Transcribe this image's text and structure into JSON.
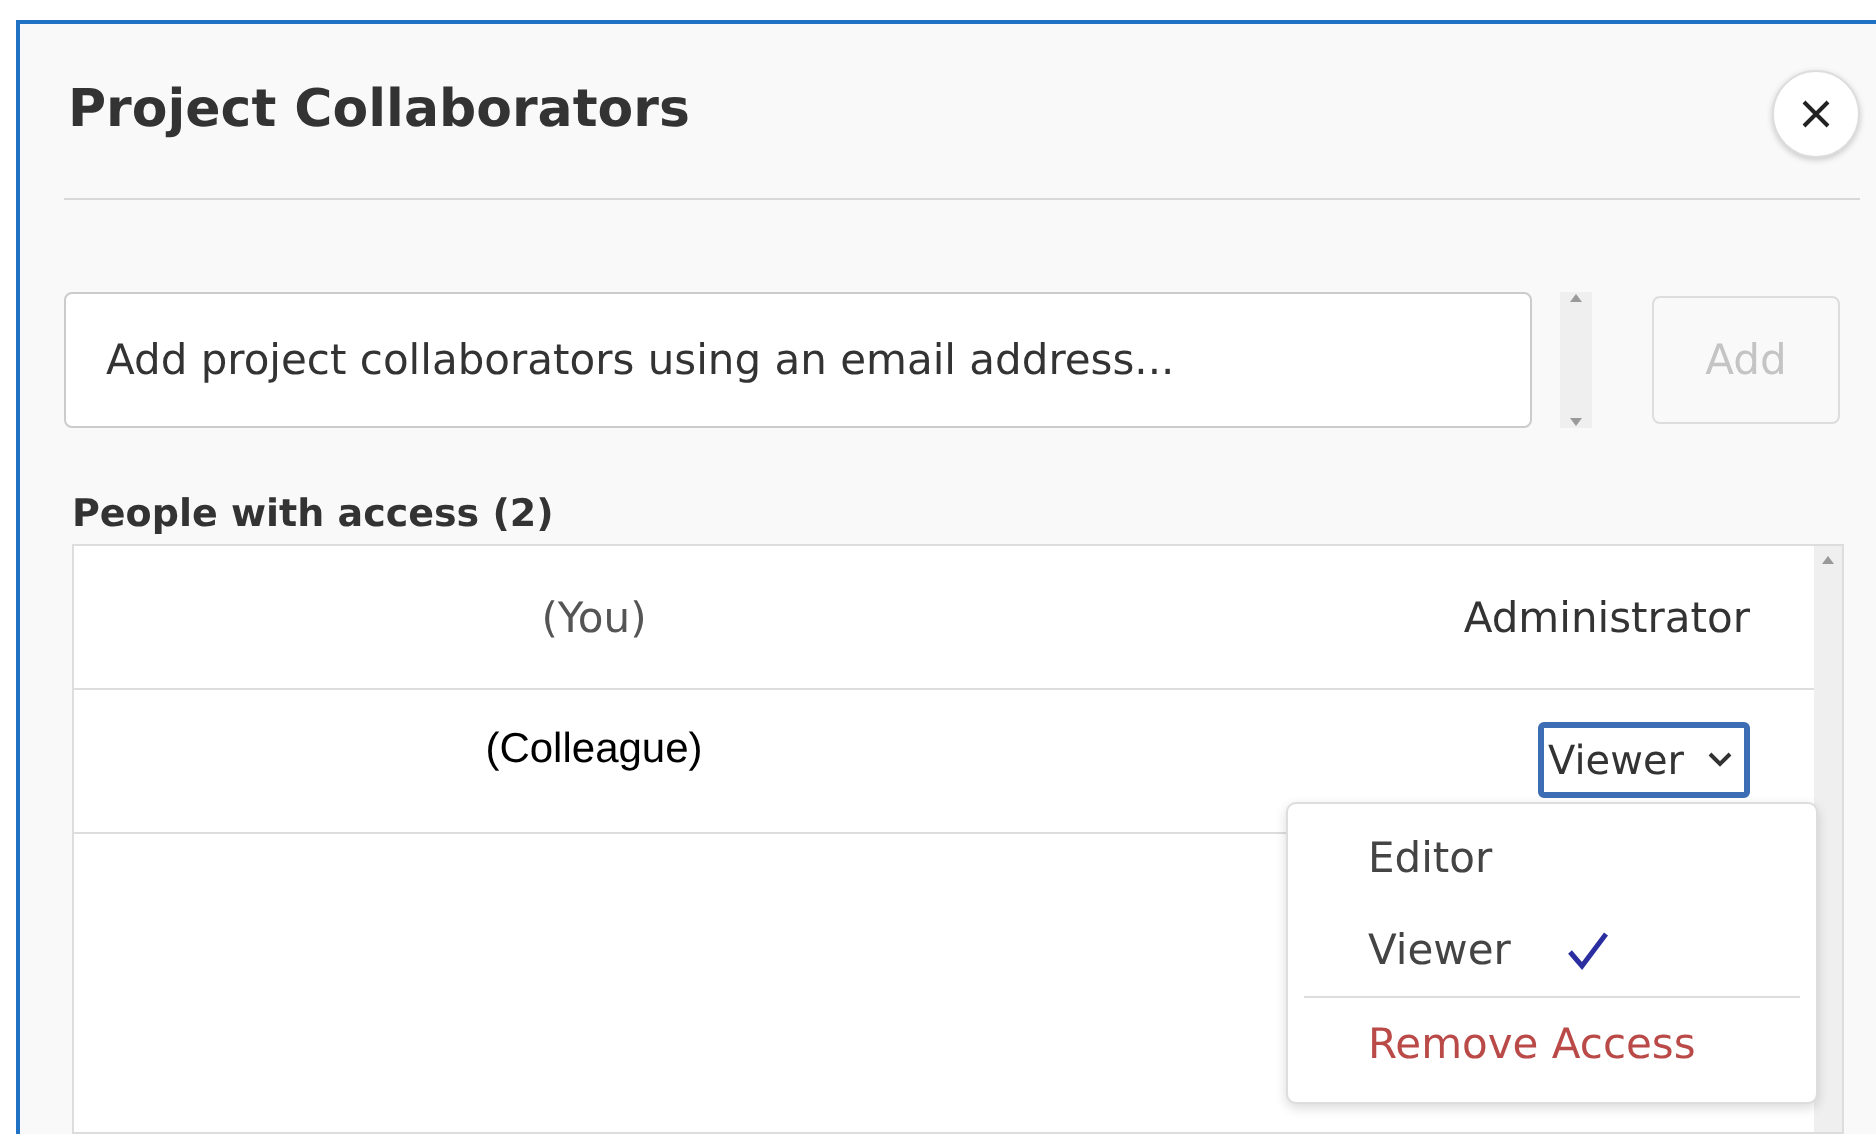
{
  "dialog": {
    "title": "Project Collaborators"
  },
  "invite": {
    "placeholder": "Add project collaborators using an email address...",
    "button": {
      "label": "Add",
      "disabled": true
    }
  },
  "access": {
    "heading": "People with access (2)",
    "rows": [
      {
        "name": "(You)",
        "role": "Administrator",
        "kind": "static"
      },
      {
        "name": "(Colleague)",
        "role": "Viewer",
        "kind": "select",
        "focused": true
      }
    ]
  },
  "role_menu": {
    "items": [
      {
        "label": "Editor",
        "kind": "option",
        "selected": false
      },
      {
        "label": "Viewer",
        "kind": "option",
        "selected": true
      },
      {
        "label": "Remove Access",
        "kind": "danger",
        "selected": false
      }
    ]
  }
}
